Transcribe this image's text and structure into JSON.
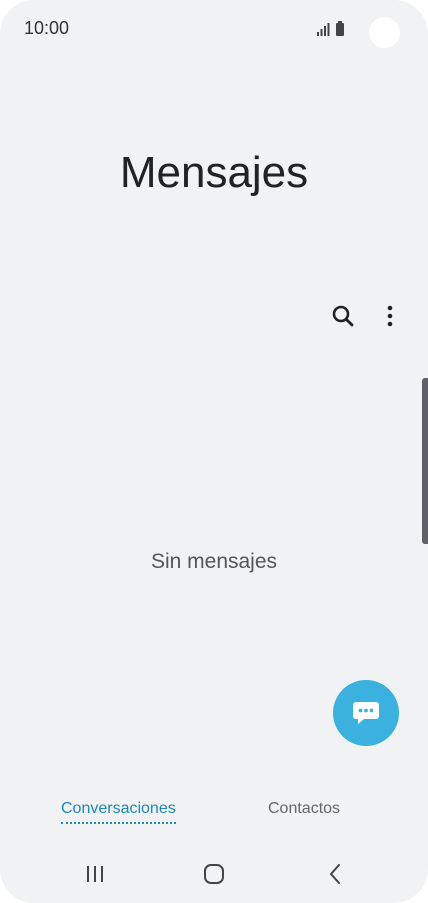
{
  "status_bar": {
    "time": "10:00",
    "icons": [
      "signal-icon",
      "battery-icon"
    ]
  },
  "app": {
    "title": "Mensajes",
    "empty_state": "Sin mensajes"
  },
  "toolbar": {
    "search_icon": "search-icon",
    "more_icon": "more-vertical-icon"
  },
  "fab": {
    "icon": "chat-icon",
    "color": "#3ab1de"
  },
  "tabs": [
    {
      "label": "Conversaciones",
      "active": true
    },
    {
      "label": "Contactos",
      "active": false
    }
  ],
  "nav": {
    "icons": [
      "recents-icon",
      "home-icon",
      "back-icon"
    ]
  },
  "colors": {
    "accent": "#1e88b6",
    "fab": "#3ab1de",
    "background": "#f1f2f3"
  }
}
